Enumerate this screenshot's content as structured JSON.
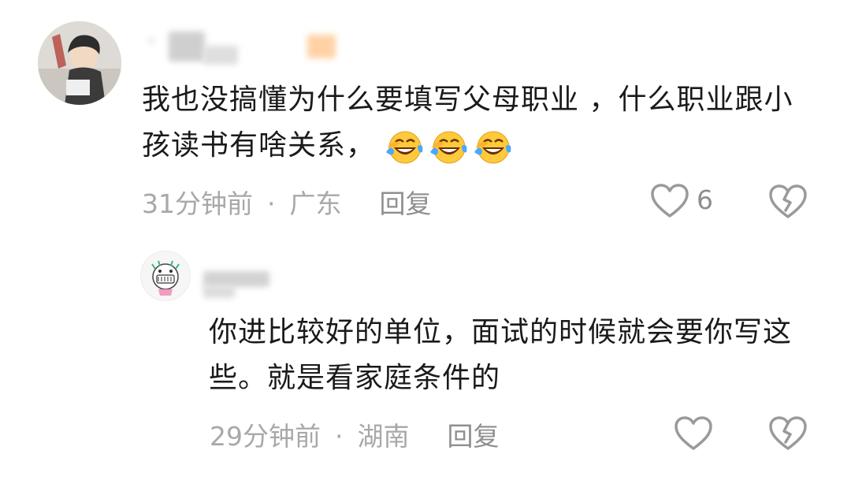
{
  "comments": [
    {
      "text": "我也没搞懂为什么要填写父母职业 ，什么职业跟小孩读书有啥关系，",
      "emojis": [
        "laughing-crying-emoji",
        "laughing-crying-emoji",
        "laughing-crying-emoji"
      ],
      "time": "31分钟前",
      "separator": "·",
      "location": "广东",
      "reply_label": "回复",
      "like_count": "6"
    },
    {
      "text": "你进比较好的单位，面试的时候就会要你写这些。就是看家庭条件的",
      "time": "29分钟前",
      "separator": "·",
      "location": "湖南",
      "reply_label": "回复"
    }
  ],
  "icons": {
    "like": "heart-outline-icon",
    "dislike": "broken-heart-icon",
    "emoji": "laughing-crying-emoji"
  },
  "colors": {
    "text": "#1a1a1a",
    "meta": "#a8a8a8",
    "icon": "#9a9a9a",
    "emoji_face": "#ffc93c",
    "emoji_tear": "#4aa8ff"
  }
}
